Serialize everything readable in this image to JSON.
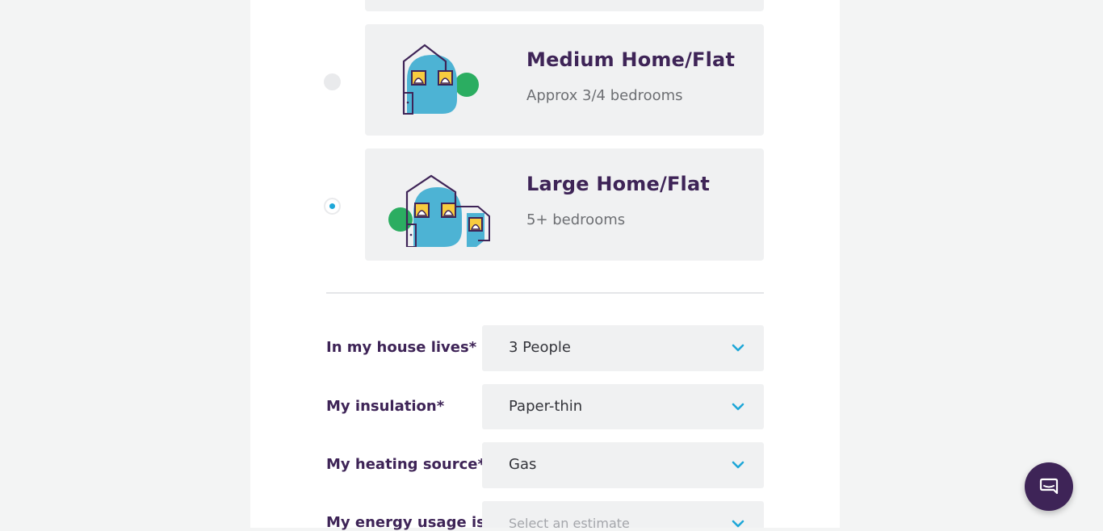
{
  "options": [
    {
      "title": "Medium Home/Flat",
      "subtitle": "Approx 3/4 bedrooms",
      "selected": false,
      "icon": "medium-house-icon"
    },
    {
      "title": "Large Home/Flat",
      "subtitle": "5+ bedrooms",
      "selected": true,
      "icon": "large-house-icon"
    }
  ],
  "form": {
    "occupants": {
      "label": "In my house lives*",
      "value": "3 People"
    },
    "insulation": {
      "label": "My insulation*",
      "value": "Paper-thin"
    },
    "heating": {
      "label": "My heating source*",
      "value": "Gas"
    },
    "usage": {
      "label": "My energy usage is*",
      "placeholder": "Select an estimate"
    }
  },
  "colors": {
    "brand_purple": "#3e2457",
    "accent_blue": "#1ea7d8",
    "house_blue": "#4db3d4",
    "house_green": "#2bad61",
    "window_yellow": "#f7cc3f",
    "card_bg": "#f0f1f2"
  },
  "icons": {
    "chevron": "chevron-down-icon",
    "chat": "chat-icon"
  }
}
